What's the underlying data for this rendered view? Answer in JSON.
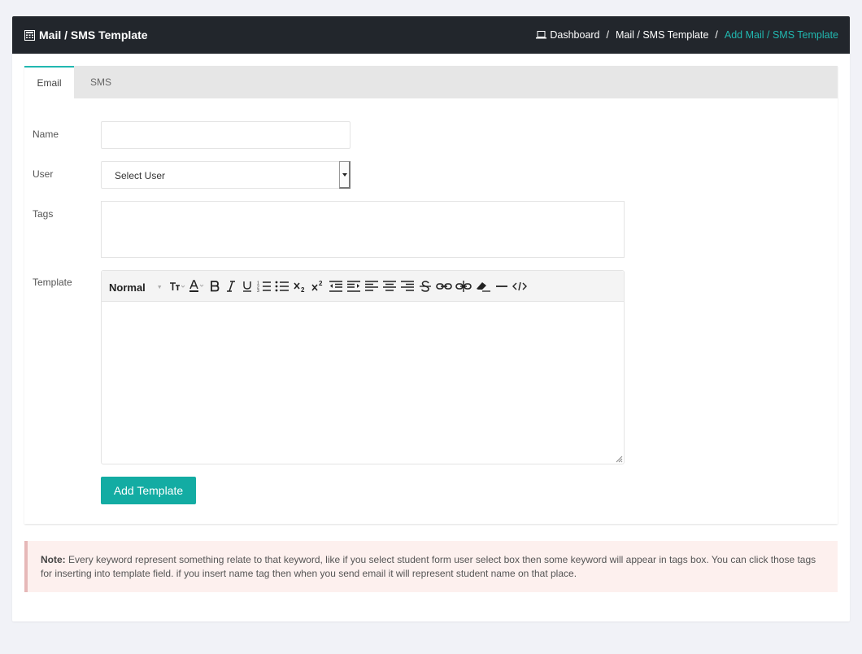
{
  "header": {
    "title": "Mail / SMS Template",
    "breadcrumb": [
      {
        "label": "Dashboard",
        "icon": "laptop-icon"
      },
      {
        "label": "Mail / SMS Template"
      },
      {
        "label": "Add Mail / SMS Template",
        "active": true
      }
    ],
    "separator": "/"
  },
  "tabs": [
    {
      "label": "Email",
      "active": true
    },
    {
      "label": "SMS",
      "active": false
    }
  ],
  "form": {
    "name_label": "Name",
    "name_value": "",
    "user_label": "User",
    "user_selected": "Select User",
    "tags_label": "Tags",
    "template_label": "Template",
    "editor_format": "Normal",
    "submit_label": "Add Template"
  },
  "note": {
    "prefix": "Note:",
    "text": "Every keyword represent something relate to that keyword, like if you select student form user select box then some keyword will appear in tags box. You can click those tags for inserting into template field. if you insert name tag then when you send email it will represent student name on that place."
  },
  "colors": {
    "accent": "#21b8b0",
    "button": "#13aca3",
    "header_bg": "#22262c",
    "note_bg": "#fdf0ee"
  }
}
